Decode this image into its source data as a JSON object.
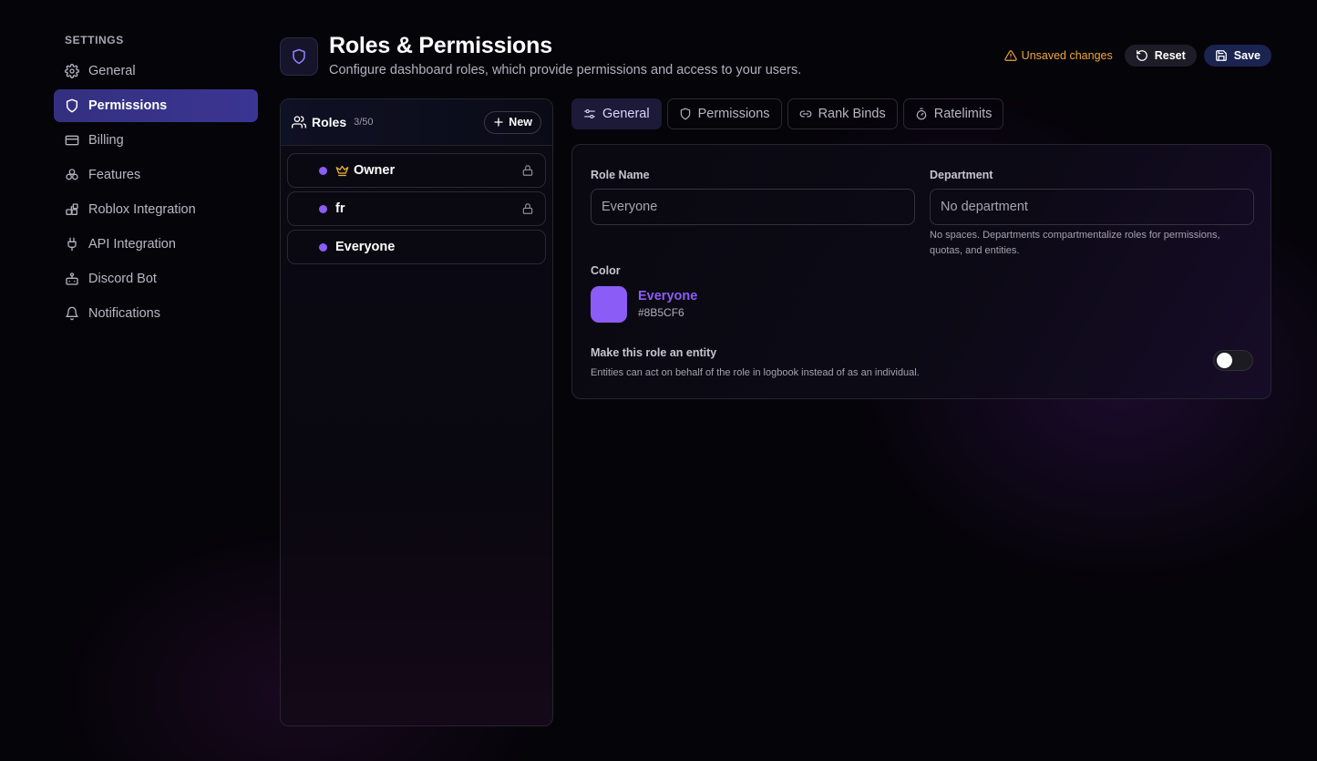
{
  "sidebar": {
    "heading": "SETTINGS",
    "items": [
      {
        "label": "General",
        "icon": "gear-icon"
      },
      {
        "label": "Permissions",
        "icon": "shield-icon",
        "active": true
      },
      {
        "label": "Billing",
        "icon": "credit-card-icon"
      },
      {
        "label": "Features",
        "icon": "features-icon"
      },
      {
        "label": "Roblox Integration",
        "icon": "blocks-icon"
      },
      {
        "label": "API Integration",
        "icon": "plug-icon"
      },
      {
        "label": "Discord Bot",
        "icon": "bot-icon"
      },
      {
        "label": "Notifications",
        "icon": "bell-icon"
      }
    ]
  },
  "header": {
    "title": "Roles & Permissions",
    "subtitle": "Configure dashboard roles, which provide permissions and access to your users.",
    "unsaved_label": "Unsaved changes",
    "reset_label": "Reset",
    "save_label": "Save"
  },
  "roles": {
    "title": "Roles",
    "count": "3/50",
    "new_label": "New",
    "items": [
      {
        "name": "Owner",
        "color": "#8B5CF6",
        "crown": true,
        "locked": true
      },
      {
        "name": "fr",
        "color": "#8B5CF6",
        "crown": false,
        "locked": true
      },
      {
        "name": "Everyone",
        "color": "#8B5CF6",
        "crown": false,
        "locked": false
      }
    ]
  },
  "tabs": [
    {
      "label": "General",
      "icon": "sliders-icon",
      "active": true
    },
    {
      "label": "Permissions",
      "icon": "shield-icon"
    },
    {
      "label": "Rank Binds",
      "icon": "link-icon"
    },
    {
      "label": "Ratelimits",
      "icon": "timer-icon"
    }
  ],
  "form": {
    "role_name_label": "Role Name",
    "role_name_placeholder": "Everyone",
    "department_label": "Department",
    "department_placeholder": "No department",
    "department_hint": "No spaces. Departments compartmentalize roles for permissions, quotas, and entities.",
    "color_label": "Color",
    "color_name": "Everyone",
    "color_hex": "#8B5CF6",
    "entity_label": "Make this role an entity",
    "entity_hint": "Entities can act on behalf of the role in logbook instead of as an individual.",
    "entity_enabled": false
  },
  "colors": {
    "accent": "#8B5CF6",
    "warning": "#F0A63A",
    "nav_active": "#3B3593"
  }
}
